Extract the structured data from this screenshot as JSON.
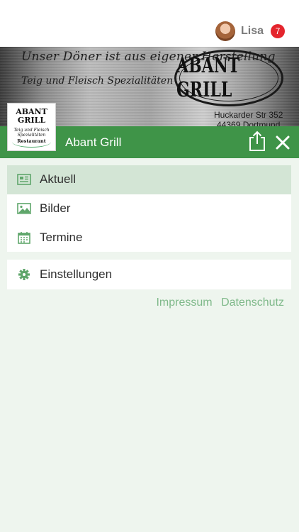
{
  "user": {
    "name": "Lisa",
    "notification_count": "7"
  },
  "banner": {
    "tagline1": "Unser Döner ist aus eigener Herstellung",
    "tagline2": "Teig und Fleisch Spezialitäten",
    "brand": "ABANT GRILL",
    "address_line1": "Huckarder Str 352",
    "address_line2": "44369 Dortmund"
  },
  "logo": {
    "title": "ABANT GRILL",
    "subtitle": "Teig und Fleisch Spezialitäten",
    "type": "Restaurant"
  },
  "header": {
    "title": "Abant Grill"
  },
  "menu": {
    "items": [
      {
        "label": "Aktuell",
        "icon": "newspaper-icon",
        "active": true
      },
      {
        "label": "Bilder",
        "icon": "image-icon",
        "active": false
      },
      {
        "label": "Termine",
        "icon": "calendar-icon",
        "active": false
      }
    ],
    "settings": {
      "label": "Einstellungen",
      "icon": "gear-icon"
    }
  },
  "footer": {
    "impressum": "Impressum",
    "datenschutz": "Datenschutz"
  },
  "colors": {
    "accent_green": "#3f9448",
    "active_item_bg": "#d3e5d5",
    "page_bg": "#eef5ee",
    "link_green": "#7fb98a",
    "badge_red": "#e4252d",
    "icon_green": "#5fa66b"
  }
}
